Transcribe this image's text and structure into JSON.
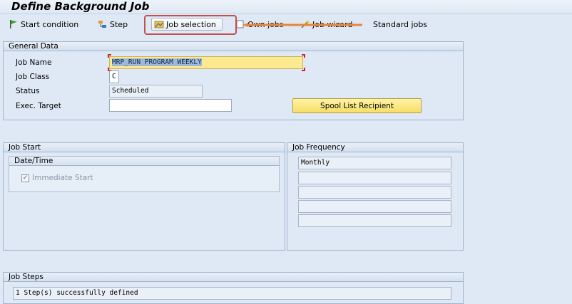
{
  "window": {
    "title": "Define Background Job"
  },
  "toolbar": {
    "start_condition": "Start condition",
    "step": "Step",
    "job_selection": "Job selection",
    "own_jobs": "Own jobs",
    "job_wizard": "Job wizard",
    "standard_jobs": "Standard jobs"
  },
  "general": {
    "header": "General Data",
    "job_name_label": "Job Name",
    "job_name_value": "MRP_RUN PROGRAM WEEKLY",
    "job_class_label": "Job Class",
    "job_class_value": "C",
    "status_label": "Status",
    "status_value": "Scheduled",
    "exec_target_label": "Exec. Target",
    "exec_target_value": "",
    "spool_button": "Spool List Recipient"
  },
  "job_start": {
    "header": "Job Start",
    "sub_header": "Date/Time",
    "immediate_start": "Immediate Start",
    "immediate_checked": true
  },
  "job_frequency": {
    "header": "Job Frequency",
    "lines": [
      "Monthly",
      "",
      "",
      "",
      ""
    ]
  },
  "job_steps": {
    "header": "Job Steps",
    "message": "1 Step(s) successfully defined"
  },
  "colors": {
    "highlight": "#c0504d",
    "arrow": "#e8843a"
  }
}
